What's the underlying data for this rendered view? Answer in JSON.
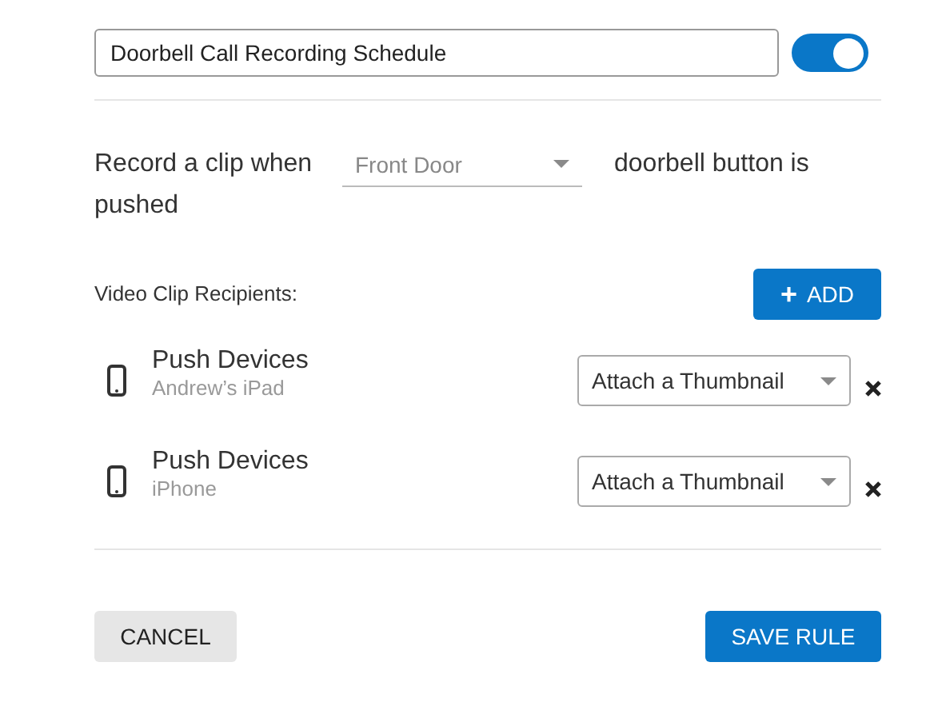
{
  "rule_name": {
    "value": "Doorbell Call Recording Schedule"
  },
  "enabled": {
    "on": true
  },
  "trigger": {
    "before": "Record a clip when",
    "door": "Front Door",
    "after": "doorbell button is",
    "after_wrap": "pushed"
  },
  "recipients_label": "Video Clip Recipients:",
  "add_button": {
    "icon": "+",
    "label": "ADD"
  },
  "recipients": [
    {
      "title": "Push Devices",
      "device": "Andrew’s iPad",
      "option": "Attach a Thumbnail"
    },
    {
      "title": "Push Devices",
      "device": "iPhone",
      "option": "Attach a Thumbnail"
    }
  ],
  "buttons": {
    "cancel": "CANCEL",
    "save": "SAVE RULE"
  }
}
